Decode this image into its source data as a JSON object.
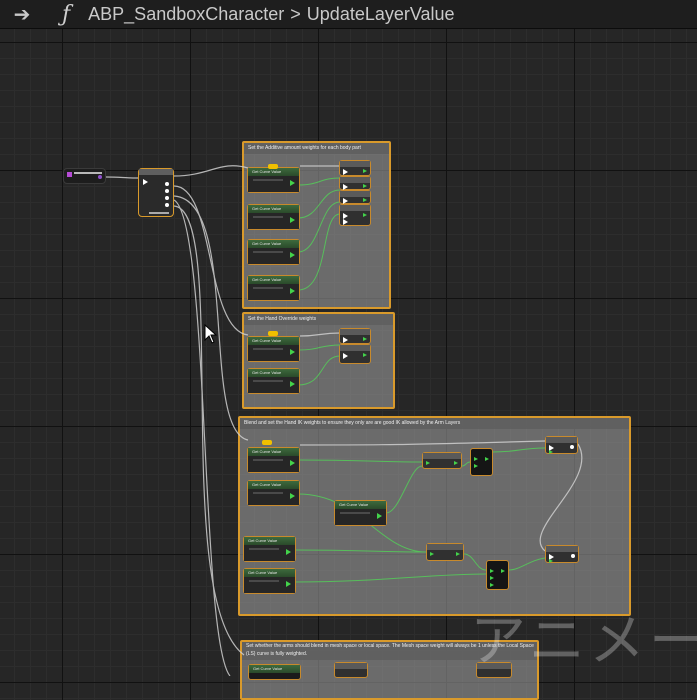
{
  "titlebar": {
    "back_icon": "arrow-right-icon",
    "function_icon": "function-icon",
    "breadcrumb": [
      "ABP_SandboxCharacter",
      "UpdateLayerValue"
    ]
  },
  "comments": [
    {
      "id": "additive-weights",
      "text": "Set the Additive amount weights for each body part"
    },
    {
      "id": "hand-override",
      "text": "Set the Hand Override weights"
    },
    {
      "id": "blend-ik",
      "text": "Blend and set the Hand IK weights to ensure they only are are good IK allowed by the Arm Layers"
    },
    {
      "id": "arms-space",
      "text": "Set whether the arms should blend in mesh space or local space. The Mesh space weight will always be 1 unless the Local Space (LS) curve is fully weighted."
    }
  ],
  "node_titles": {
    "get_curve": "Get Curve Value",
    "sequence": "Sequence"
  },
  "watermark": "アニメー"
}
